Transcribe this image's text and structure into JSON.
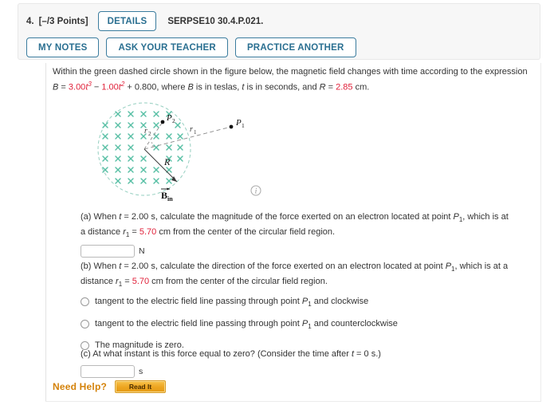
{
  "header": {
    "question_number": "4.",
    "points": "[–/3 Points]",
    "details_label": "DETAILS",
    "assignment_code": "SERPSE10 30.4.P.021.",
    "buttons": [
      {
        "label": "MY NOTES"
      },
      {
        "label": "ASK YOUR TEACHER"
      },
      {
        "label": "PRACTICE ANOTHER"
      }
    ]
  },
  "intro": {
    "line1": "Within the green dashed circle shown in the figure below, the magnetic field changes with time according to the expression",
    "eq_B": "B",
    "eq_eq": " = ",
    "coef1": "3.00",
    "t1": "t",
    "exp1": "3",
    "minus": " − ",
    "coef2": "1.00",
    "t2": "t",
    "exp2": "2",
    "plus_const": " + 0.800, where ",
    "B_label": "B",
    "mid1": " is in teslas, ",
    "t_label": "t",
    "mid2": " is in seconds, and ",
    "R_label": "R",
    "eq2": " = ",
    "R_value": "2.85",
    "unit_cm": " cm."
  },
  "figure": {
    "label_P1": "P",
    "label_P1_sub": "1",
    "label_P2": "P",
    "label_P2_sub": "2",
    "label_r1": "r",
    "label_r1_sub": "1",
    "label_r2": "r",
    "label_r2_sub": "2",
    "label_R": "R",
    "label_B": "B",
    "label_B_sub": "in",
    "cross_color": "#59bfa5",
    "circle_color": "#8ccdbd",
    "info_icon": "info-circle-icon"
  },
  "part_a": {
    "prefix": "(a) When ",
    "t_var": "t",
    "t_eq": " = 2.00 s, calculate the magnitude of the force exerted on an electron located at point ",
    "P_var": "P",
    "P_sub": "1",
    "after_P": ", which is at a distance ",
    "r_var": "r",
    "r_sub": "1",
    "r_eq": " = ",
    "r_value": "5.70",
    "tail": " cm from the center of the circular field region.",
    "input_value": "",
    "unit": "N"
  },
  "part_b": {
    "prefix": "(b) When ",
    "t_var": "t",
    "t_eq": " = 2.00 s, calculate the direction of the force exerted on an electron located at point ",
    "P_var": "P",
    "P_sub": "1",
    "after_P": ", which is at a distance ",
    "r_var": "r",
    "r_sub": "1",
    "r_eq": " = ",
    "r_value": "5.70",
    "tail": " cm from the center of the circular field region.",
    "options": [
      {
        "pre": "tangent to the electric field line passing through point ",
        "P_var": "P",
        "P_sub": "1",
        "post": " and clockwise",
        "selected": false
      },
      {
        "pre": "tangent to the electric field line passing through point ",
        "P_var": "P",
        "P_sub": "1",
        "post": " and counterclockwise",
        "selected": false
      },
      {
        "pre": "The magnitude is zero.",
        "P_var": "",
        "P_sub": "",
        "post": "",
        "selected": false
      }
    ]
  },
  "part_c": {
    "prefix": "(c) At what instant is this force equal to zero? (Consider the time after ",
    "t_var": "t",
    "tail": " = 0 s.)",
    "input_value": "",
    "unit": "s"
  },
  "need_help": {
    "label": "Need Help?",
    "read_it_label": "Read It"
  },
  "colors": {
    "accent_blue": "#2a6f91",
    "red_value": "#e0213a",
    "orange": "#d4820a",
    "teal": "#59bfa5"
  }
}
